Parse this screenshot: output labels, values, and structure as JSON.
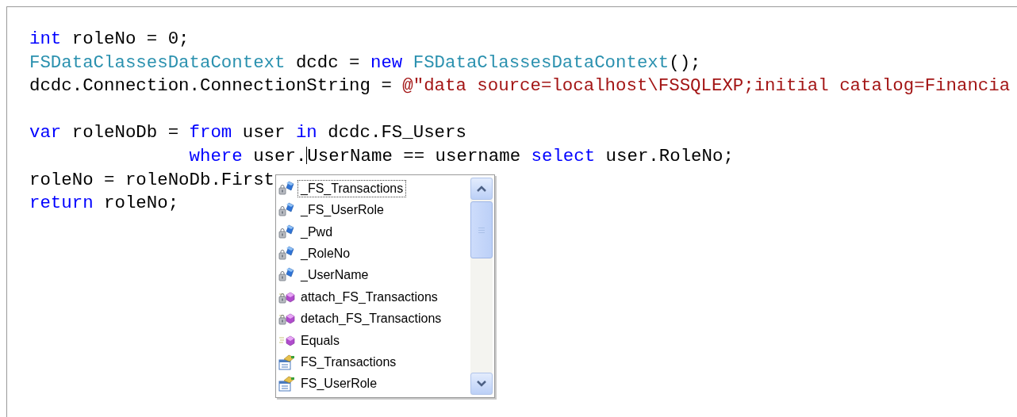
{
  "editor": {
    "lines": [
      {
        "kind": "code",
        "tokens": [
          {
            "kind": "keyword",
            "text": "int"
          },
          {
            "kind": "plain",
            "text": " roleNo = 0;"
          }
        ]
      },
      {
        "kind": "code",
        "tokens": [
          {
            "kind": "type",
            "text": "FSDataClassesDataContext"
          },
          {
            "kind": "plain",
            "text": " dcdc = "
          },
          {
            "kind": "keyword",
            "text": "new "
          },
          {
            "kind": "type",
            "text": "FSDataClassesDataContext"
          },
          {
            "kind": "plain",
            "text": "();"
          }
        ]
      },
      {
        "kind": "code",
        "tokens": [
          {
            "kind": "plain",
            "text": "dcdc.Connection.ConnectionString = "
          },
          {
            "kind": "string",
            "text": "@\"data source=localhost\\FSSQLEXP;initial catalog=Financia"
          }
        ]
      },
      {
        "kind": "blank"
      },
      {
        "kind": "code",
        "tokens": [
          {
            "kind": "keyword",
            "text": "var"
          },
          {
            "kind": "plain",
            "text": " roleNoDb = "
          },
          {
            "kind": "keyword",
            "text": "from"
          },
          {
            "kind": "plain",
            "text": " user "
          },
          {
            "kind": "keyword",
            "text": "in"
          },
          {
            "kind": "plain",
            "text": " dcdc.FS_Users"
          }
        ]
      },
      {
        "kind": "continuation",
        "tokens": [
          {
            "kind": "keyword",
            "text": "where"
          },
          {
            "kind": "plain",
            "text": " user."
          },
          {
            "kind": "caret"
          },
          {
            "kind": "plain",
            "text": "UserName == username "
          },
          {
            "kind": "keyword",
            "text": "select"
          },
          {
            "kind": "plain",
            "text": " user.RoleNo;"
          }
        ]
      },
      {
        "kind": "code",
        "tokens": [
          {
            "kind": "plain",
            "text": "roleNo = roleNoDb.First"
          }
        ]
      },
      {
        "kind": "code",
        "tokens": [
          {
            "kind": "keyword",
            "text": "return"
          },
          {
            "kind": "plain",
            "text": " roleNo;"
          }
        ]
      }
    ]
  },
  "completion_list": {
    "items": [
      {
        "kind": "private-field",
        "label": "_FS_Transactions",
        "selected": true
      },
      {
        "kind": "private-field",
        "label": "_FS_UserRole",
        "selected": false
      },
      {
        "kind": "private-field",
        "label": "_Pwd",
        "selected": false
      },
      {
        "kind": "private-field",
        "label": "_RoleNo",
        "selected": false
      },
      {
        "kind": "private-field",
        "label": "_UserName",
        "selected": false
      },
      {
        "kind": "private-method",
        "label": "attach_FS_Transactions",
        "selected": false
      },
      {
        "kind": "private-method",
        "label": "detach_FS_Transactions",
        "selected": false
      },
      {
        "kind": "method",
        "label": "Equals",
        "selected": false
      },
      {
        "kind": "property",
        "label": "FS_Transactions",
        "selected": false
      },
      {
        "kind": "property",
        "label": "FS_UserRole",
        "selected": false
      }
    ]
  }
}
